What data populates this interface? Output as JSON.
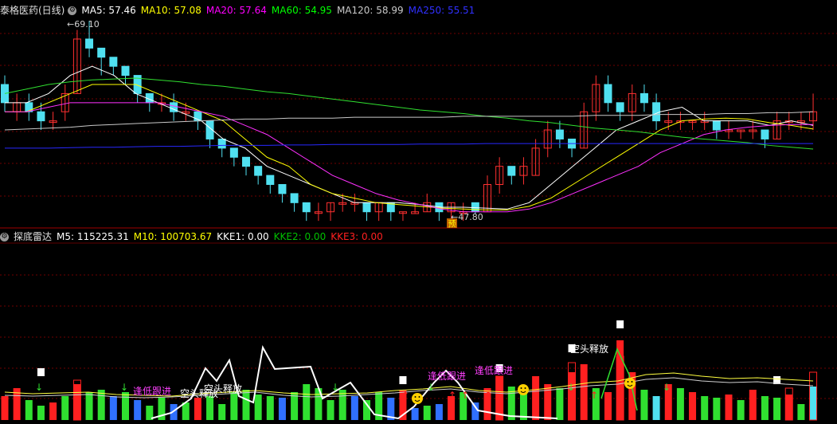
{
  "main_panel": {
    "title": "泰格医药(日线)",
    "indicators": [
      {
        "label": "MA5: 57.46",
        "color": "#ffffff"
      },
      {
        "label": "MA10: 57.08",
        "color": "#ffff00"
      },
      {
        "label": "MA20: 57.64",
        "color": "#ff00ff"
      },
      {
        "label": "MA60: 54.95",
        "color": "#00ff00"
      },
      {
        "label": "MA120: 58.99",
        "color": "#c8c8c8"
      },
      {
        "label": "MA250: 55.51",
        "color": "#3030ff"
      }
    ],
    "high_label": "69.10",
    "low_label": "47.80",
    "badge": "预"
  },
  "sub_panel": {
    "title": "探底雷达",
    "indicators": [
      {
        "label": "M5: 115225.31",
        "color": "#ffffff"
      },
      {
        "label": "M10: 100703.67",
        "color": "#ffff00"
      },
      {
        "label": "KKE1: 0.00",
        "color": "#ffffff"
      },
      {
        "label": "KKE2: 0.00",
        "color": "#00c000"
      },
      {
        "label": "KKE3: 0.00",
        "color": "#ff2020"
      }
    ],
    "annotations": [
      {
        "text": "逢低跟进",
        "color": "#ff40ff"
      },
      {
        "text": "空头释放",
        "color": "#ffffff"
      },
      {
        "text": "空头释放",
        "color": "#ffffff"
      },
      {
        "text": "逢低跟进",
        "color": "#ff40ff"
      },
      {
        "text": "逢低跟进",
        "color": "#ff40ff"
      },
      {
        "text": "空头释放",
        "color": "#ffffff"
      }
    ]
  }
}
